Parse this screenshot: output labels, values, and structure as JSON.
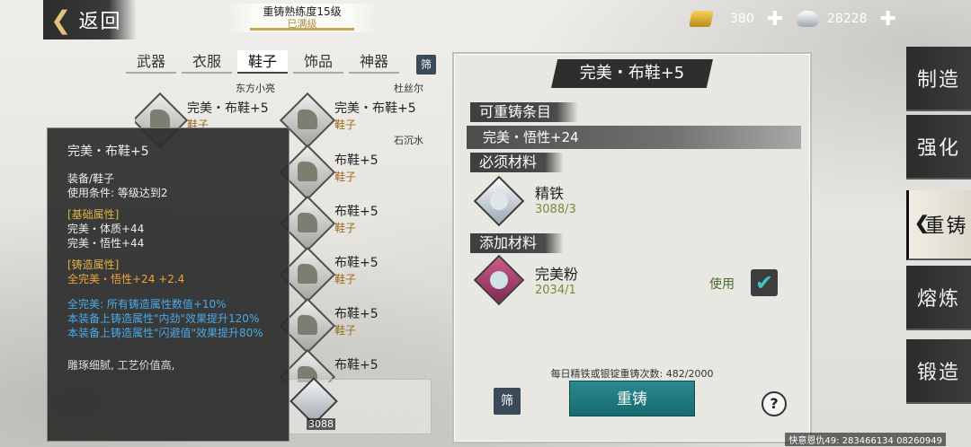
{
  "header": {
    "back_label": "返回",
    "mastery_title": "重铸熟练度15级",
    "mastery_sub": "已满级",
    "gold": "380",
    "silver": "28228"
  },
  "side_nav": [
    {
      "label": "制造",
      "active": false
    },
    {
      "label": "强化",
      "active": false
    },
    {
      "label": "重铸",
      "active": true
    },
    {
      "label": "熔炼",
      "active": false
    },
    {
      "label": "锻造",
      "active": false
    }
  ],
  "tabs": [
    {
      "label": "武器"
    },
    {
      "label": "衣服"
    },
    {
      "label": "鞋子"
    },
    {
      "label": "饰品"
    },
    {
      "label": "神器"
    }
  ],
  "filter_label": "筛",
  "list": {
    "owners": [
      "东方小亮",
      "杜丝尔",
      "石沉水"
    ],
    "items": [
      {
        "name": "完美・布鞋+5",
        "type": "鞋子"
      },
      {
        "name": "完美・布鞋+5",
        "type": "鞋子"
      },
      {
        "name": "布鞋+5",
        "type": "鞋子"
      },
      {
        "name": "布鞋+5",
        "type": "鞋子"
      },
      {
        "name": "布鞋+5",
        "type": "鞋子"
      },
      {
        "name": "布鞋+5",
        "type": "鞋子"
      },
      {
        "name": "布鞋+5",
        "type": ""
      }
    ],
    "material_count": "3088"
  },
  "tooltip": {
    "title": "完美・布鞋+5",
    "category": "装备/鞋子",
    "requirement": "使用条件:  等级达到2",
    "base_header": "[基础属性]",
    "base_1": "完美・体质+44",
    "base_2": "完美・悟性+44",
    "forge_header": "[铸造属性]",
    "forge_1": "全完美・悟性+24  +2.4",
    "set_1": "全完美: 所有铸造属性数值+10%",
    "set_2": "本装备上铸造属性\"内劲\"效果提升120%",
    "set_3": "本装备上铸造属性\"闪避值\"效果提升80%",
    "desc": "雕琢细腻, 工艺价值高,"
  },
  "panel": {
    "title": "完美・布鞋+5",
    "reforge_header": "可重铸条目",
    "reforge_stat": "完美・悟性+24",
    "required_header": "必须材料",
    "required_name": "精铁",
    "required_count": "3088/3",
    "extra_header": "添加材料",
    "extra_name": "完美粉",
    "extra_count": "2034/1",
    "use_label": "使用",
    "daily_text": "每日精铁或银锭重铸次数: 482/2000",
    "reforge_button": "重铸",
    "filter_label": "筛",
    "help_label": "?"
  },
  "footer_id": "快意恩仇49: 283466134  08260949"
}
